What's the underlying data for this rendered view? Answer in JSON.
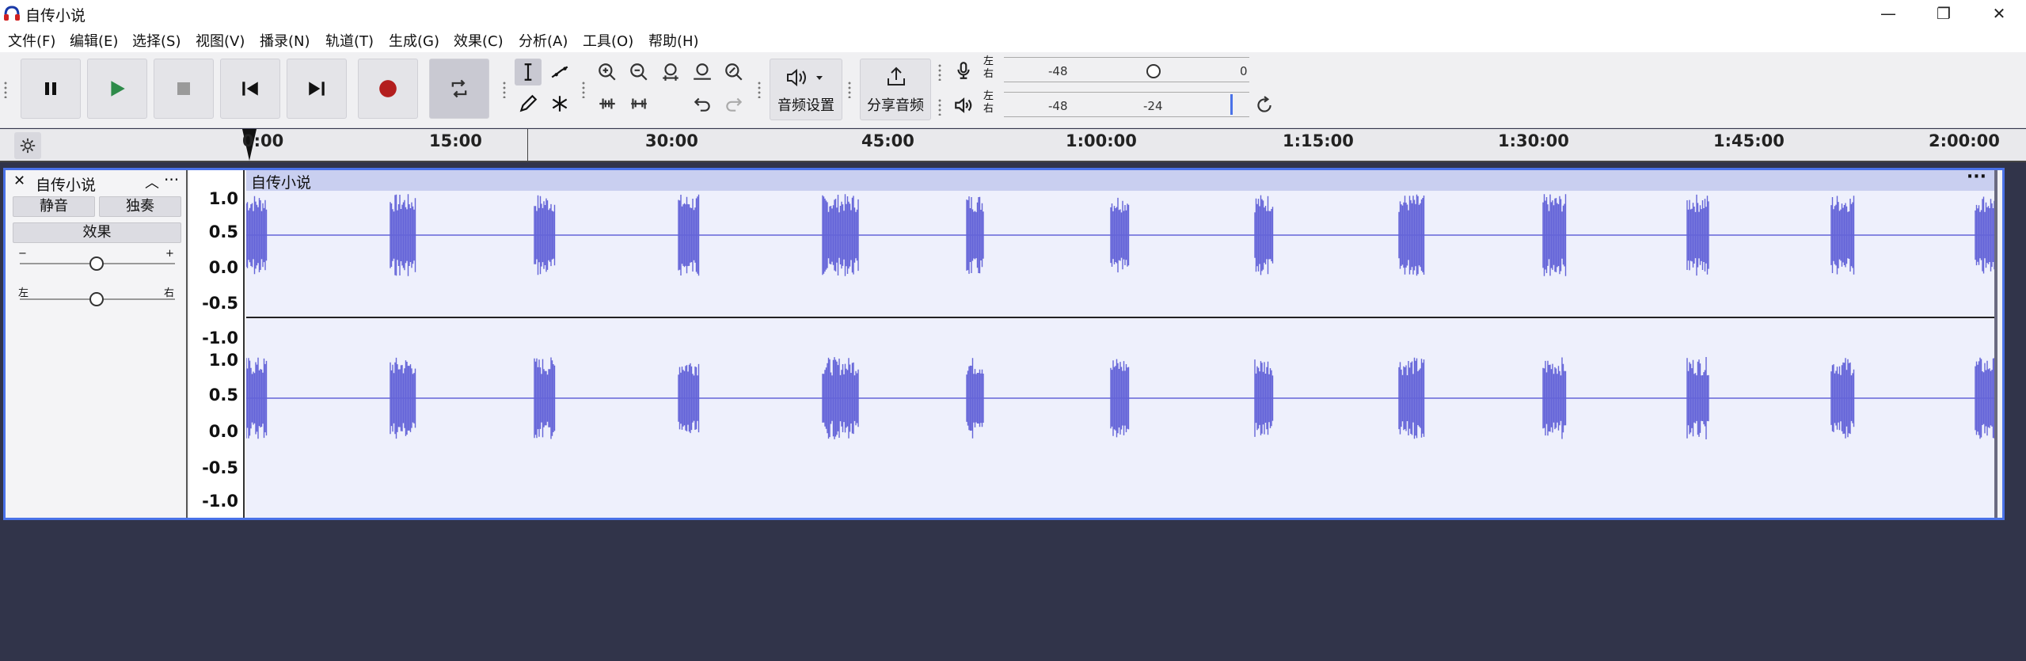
{
  "window": {
    "title": "自传小说",
    "controls": [
      "minimize-icon",
      "restore-icon",
      "close-icon"
    ]
  },
  "menu": [
    "文件(F)",
    "编辑(E)",
    "选择(S)",
    "视图(V)",
    "播录(N)",
    "轨道(T)",
    "生成(G)",
    "效果(C)",
    "分析(A)",
    "工具(O)",
    "帮助(H)"
  ],
  "toolbar": {
    "transport": [
      "pause-icon",
      "play-icon",
      "stop-icon",
      "skip-start-icon",
      "skip-end-icon",
      "record-icon",
      "loop-icon"
    ],
    "audio_setup_label": "音频设置",
    "share_audio_label": "分享音频",
    "rec_meter": {
      "lr": [
        "左",
        "右"
      ],
      "ticks": [
        "-48",
        "0"
      ]
    },
    "play_meter": {
      "lr": [
        "左",
        "右"
      ],
      "ticks": [
        "-48",
        "-24"
      ]
    },
    "accent": "#c62828"
  },
  "ruler": {
    "labels": [
      "0:00",
      "15:00",
      "30:00",
      "45:00",
      "1:00:00",
      "1:15:00",
      "1:30:00",
      "1:45:00",
      "2:00:00"
    ]
  },
  "track": {
    "name": "自传小说",
    "mute_label": "静音",
    "solo_label": "独奏",
    "effects_label": "效果",
    "gain_minus": "−",
    "gain_plus": "+",
    "pan_left": "左",
    "pan_right": "右",
    "gain_level": 0.5,
    "pan_level": 0.5,
    "clip_name": "自传小说",
    "clip_menu": "···",
    "channel_scale": [
      "1.0",
      "0.5",
      "0.0",
      "-0.5",
      "-1.0"
    ],
    "wave_color": "#6464d8",
    "bursts_per_channel": 13
  },
  "colors": {
    "selection_border": "#4a72e8",
    "background": "#31344a"
  }
}
